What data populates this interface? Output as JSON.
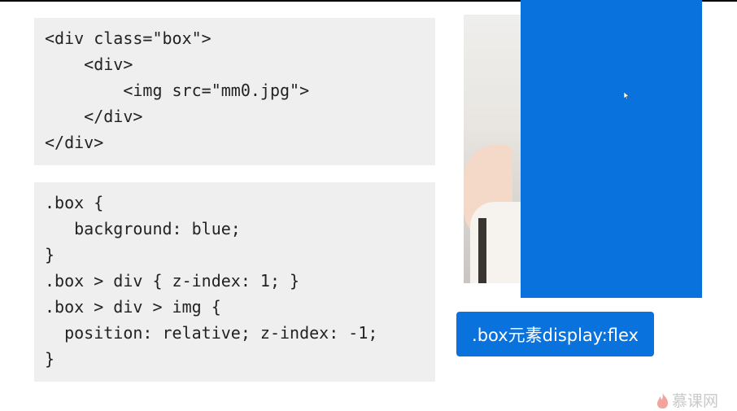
{
  "html_code": {
    "lines": [
      "<div class=\"box\">",
      "    <div>",
      "        <img src=\"mm0.jpg\">",
      "    </div>",
      "</div>"
    ]
  },
  "css_code": {
    "lines": [
      ".box {",
      "   background: blue;",
      "}",
      ".box > div { z-index: 1; }",
      ".box > div > img {",
      "  position: relative; z-index: -1;",
      "}"
    ]
  },
  "demo": {
    "box_color": "#0a72dc",
    "button_label": ".box元素display:flex"
  },
  "watermark": {
    "text": "慕课网"
  }
}
